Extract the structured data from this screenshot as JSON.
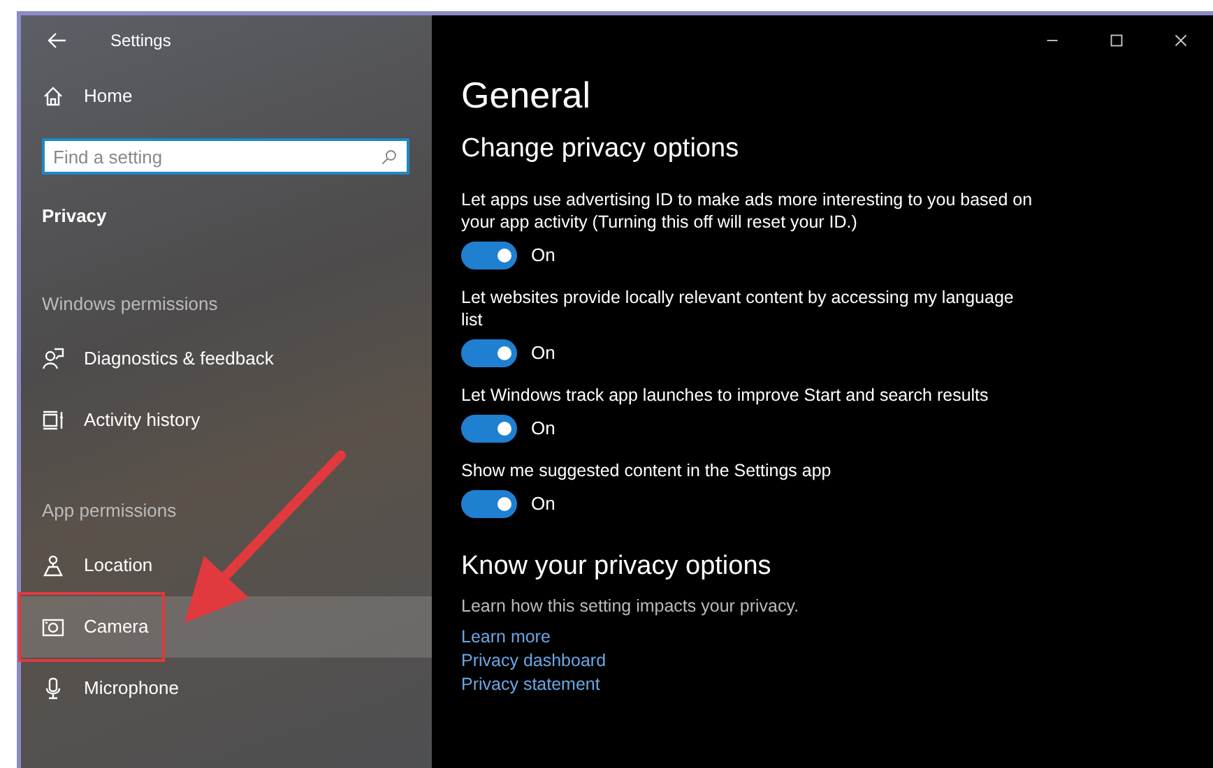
{
  "window": {
    "title": "Settings"
  },
  "sidebar": {
    "items": [
      {
        "kind": "nav",
        "label": "Home",
        "selected": false,
        "highlighted": false
      },
      {
        "kind": "search",
        "placeholder": "Find a setting"
      },
      {
        "kind": "heading",
        "label": "Privacy"
      },
      {
        "kind": "section",
        "label": "Windows permissions"
      },
      {
        "kind": "nav",
        "label": "Diagnostics & feedback",
        "selected": false,
        "highlighted": false
      },
      {
        "kind": "nav",
        "label": "Activity history",
        "selected": false,
        "highlighted": false
      },
      {
        "kind": "section",
        "label": "App permissions"
      },
      {
        "kind": "nav",
        "label": "Location",
        "selected": false,
        "highlighted": false
      },
      {
        "kind": "nav",
        "label": "Camera",
        "selected": true,
        "highlighted": true
      },
      {
        "kind": "nav",
        "label": "Microphone",
        "selected": false,
        "highlighted": false
      }
    ]
  },
  "content": {
    "title": "General",
    "subtitle": "Change privacy options",
    "settings": [
      {
        "description": "Let apps use advertising ID to make ads more interesting to you based on your app activity (Turning this off will reset your ID.)",
        "on": true,
        "state_label": "On"
      },
      {
        "description": "Let websites provide locally relevant content by accessing my language list",
        "on": true,
        "state_label": "On"
      },
      {
        "description": "Let Windows track app launches to improve Start and search results",
        "on": true,
        "state_label": "On"
      },
      {
        "description": "Show me suggested content in the Settings app",
        "on": true,
        "state_label": "On"
      }
    ],
    "know": {
      "title": "Know your privacy options",
      "text": "Learn how this setting impacts your privacy.",
      "links": [
        "Learn more",
        "Privacy dashboard",
        "Privacy statement"
      ]
    }
  }
}
